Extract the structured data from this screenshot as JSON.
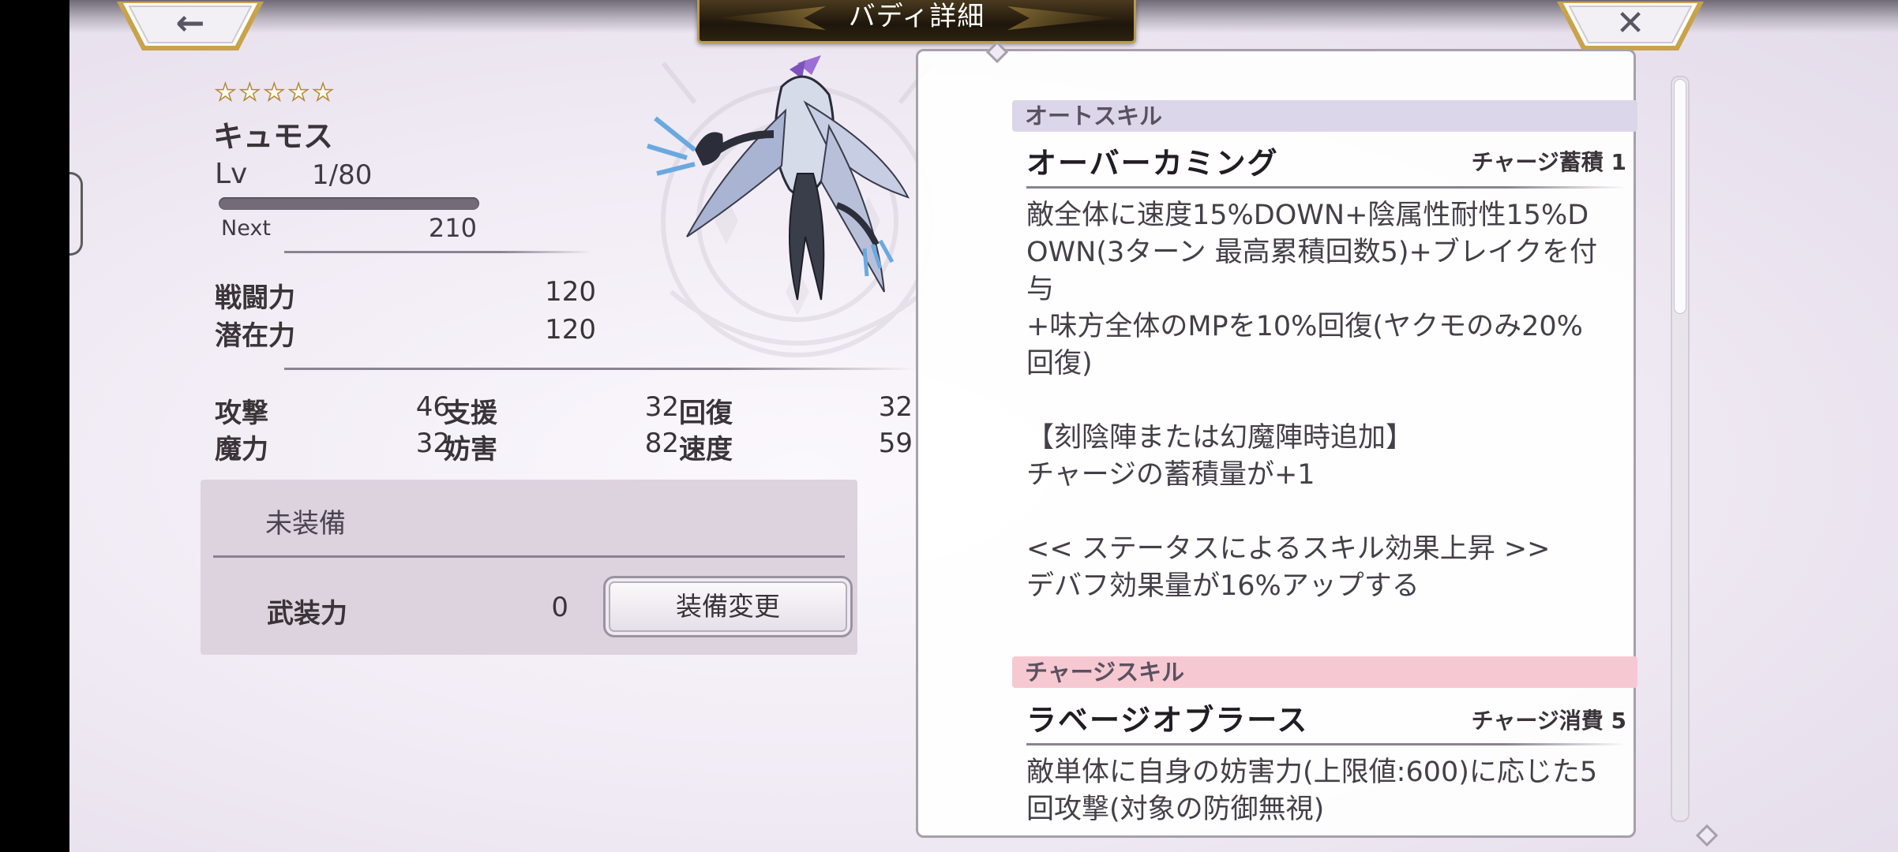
{
  "header": {
    "title": "バディ詳細",
    "back_icon_glyph": "←",
    "close_icon_glyph": "✕"
  },
  "buddy": {
    "rarity_stars": 5,
    "star_glyph": "★",
    "name": "キュモス",
    "level_label": "Lv",
    "level_value": "1/80",
    "exp_progress": 0,
    "next_label": "Next",
    "next_value": "210",
    "combat_power_label": "戦闘力",
    "combat_power_value": "120",
    "potential_label": "潜在力",
    "potential_value": "120",
    "stats": [
      {
        "label": "攻撃",
        "value": "46"
      },
      {
        "label": "支援",
        "value": "32"
      },
      {
        "label": "回復",
        "value": "32"
      },
      {
        "label": "魔力",
        "value": "32"
      },
      {
        "label": "妨害",
        "value": "82"
      },
      {
        "label": "速度",
        "value": "59"
      }
    ]
  },
  "equipment": {
    "status": "未装備",
    "armament_label": "武装力",
    "armament_value": "0",
    "change_button": "装備変更"
  },
  "skills": {
    "auto": {
      "category": "オートスキル",
      "name": "オーバーカミング",
      "meta": "チャージ蓄積 1",
      "description": "敵全体に速度15%DOWN+陰属性耐性15%D\nOWN(3ターン 最高累積回数5)+ブレイクを付\n与\n+味方全体のMPを10%回復(ヤクモのみ20%\n回復)\n\n【刻陰陣または幻魔陣時追加】\nチャージの蓄積量が+1\n\n<< ステータスによるスキル効果上昇 >>\nデバフ効果量が16%アップする"
    },
    "charge": {
      "category": "チャージスキル",
      "name": "ラベージオブラース",
      "meta": "チャージ消費 5",
      "description": "敵単体に自身の妨害力(上限値:600)に応じた5\n回攻撃(対象の防御無視)"
    }
  },
  "colors": {
    "auto_header_bg": "#dcd6ea",
    "charge_header_bg": "#f6c9d2",
    "star_outline": "#b38a3c",
    "title_plate_border": "#b99a4b"
  }
}
